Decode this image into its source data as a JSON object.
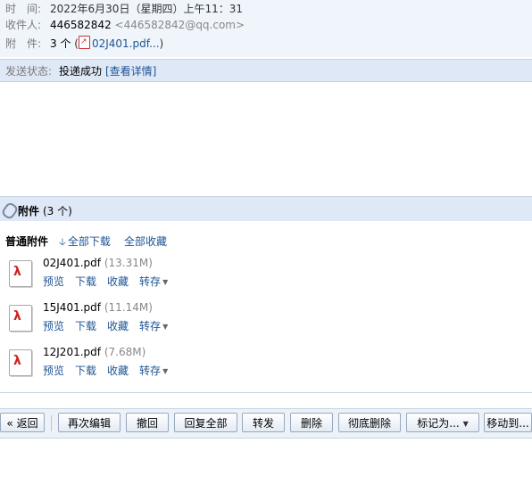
{
  "meta": {
    "time_label": "时　间:",
    "time_value": "2022年6月30日（星期四）上午11：31",
    "to_label": "收件人:",
    "to_name": "446582842",
    "to_email": "<446582842@qq.com>",
    "attach_label": "附　件:",
    "attach_count": "3 个",
    "attach_paren_open": "(",
    "attach_first": "02J401.pdf...",
    "attach_paren_close": ")"
  },
  "status": {
    "label": "发送状态:",
    "value": "投递成功",
    "link": "[查看详情]"
  },
  "attachments": {
    "title": "附件",
    "count": "(3 个)",
    "section_title": "普通附件",
    "download_all": "全部下载",
    "collect_all": "全部收藏",
    "actions": {
      "preview": "预览",
      "download": "下载",
      "collect": "收藏",
      "save_to": "转存"
    },
    "files": [
      {
        "name": "02J401.pdf",
        "size": "(13.31M)"
      },
      {
        "name": "15J401.pdf",
        "size": "(11.14M)"
      },
      {
        "name": "12J201.pdf",
        "size": "(7.68M)"
      }
    ]
  },
  "toolbar": {
    "back": "« 返回",
    "re_edit": "再次编辑",
    "recall": "撤回",
    "reply_all": "回复全部",
    "forward": "转发",
    "delete": "删除",
    "delete_perm": "彻底删除",
    "mark_as": "标记为...",
    "move_to": "移动到..."
  },
  "colors": {
    "accent": "#1e5494",
    "bar": "#dfe8f6",
    "pdf_red": "#cc2222"
  }
}
